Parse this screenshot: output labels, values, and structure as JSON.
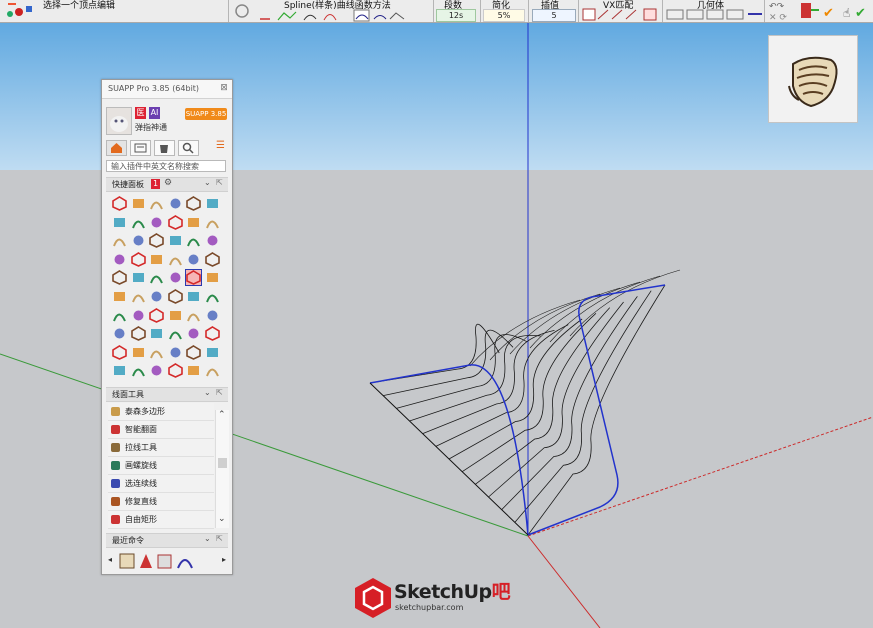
{
  "toolbar": {
    "hint": "选择一个顶点编辑",
    "spline_label": "Spline(样条)曲线函数方法",
    "segments_label": "段数",
    "segments_value": "12s",
    "simplify_label": "简化",
    "simplify_value": "5%",
    "interp_label": "插值",
    "interp_value": "5",
    "vx_label": "VX匹配",
    "geometry_label": "几何体"
  },
  "panel": {
    "title": "SUAPP Pro 3.85 (64bit)",
    "badge_a": "医",
    "badge_b": "AI",
    "version_button": "SUAPP 3.85",
    "user_name": "弹指神通",
    "search_placeholder": "输入插件中英文名称搜索",
    "quick_panel": "快捷面板",
    "quick_panel_num": "1",
    "line_tools": "线面工具",
    "recent": "最近命令",
    "tools": [
      "泰森多边形",
      "智能翻面",
      "拉线工具",
      "画螺旋线",
      "选连续线",
      "修复直线",
      "自由矩形"
    ]
  },
  "watermark": {
    "brand": "SketchUp",
    "brand_suffix": "吧",
    "url": "sketchupbar.com"
  },
  "colors": {
    "axis_blue": "#2233cc",
    "axis_red": "#cc2a2a",
    "axis_green": "#3a9a3a",
    "sky_top": "#5fa8e0",
    "ground": "#c6c8cb",
    "version_orange": "#f08a1a"
  },
  "icons": [
    "home-icon",
    "list-icon",
    "bucket-icon",
    "magnifier-icon",
    "gear-icon",
    "close-icon",
    "chevron-down-icon",
    "chevron-up-icon",
    "popout-icon"
  ]
}
